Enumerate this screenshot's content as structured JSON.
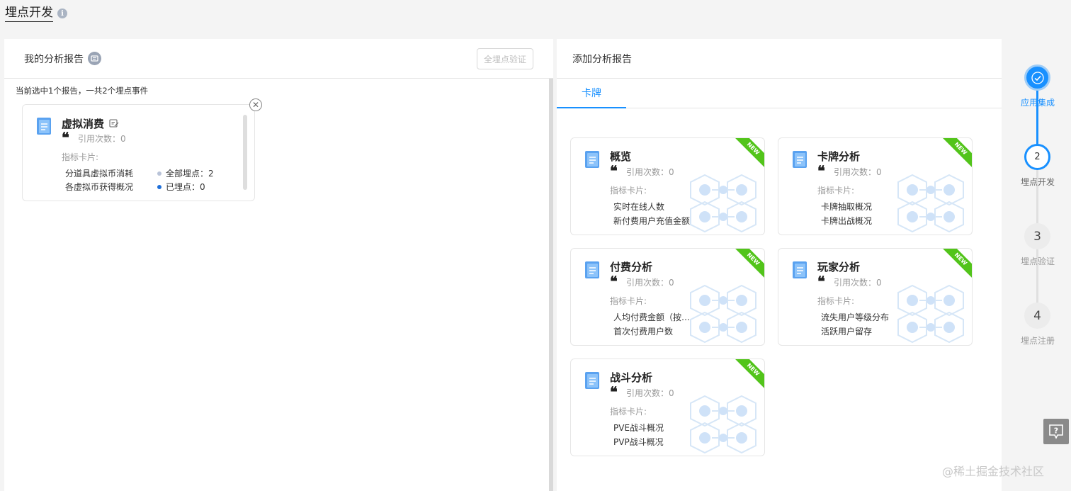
{
  "page": {
    "title": "埋点开发"
  },
  "left": {
    "title": "我的分析报告",
    "verify_button": "全埋点验证",
    "selected_info": "当前选中1个报告，一共2个埋点事件",
    "card": {
      "name": "虚拟消费",
      "ref_count": "引用次数：0",
      "metric_label": "指标卡片:",
      "metrics": [
        "分道具虚拟币消耗",
        "各虚拟币获得概况"
      ],
      "legend": [
        {
          "label": "全部埋点：2",
          "color": "#b9c3d8"
        },
        {
          "label": "已埋点：0",
          "color": "#1e6fd9"
        }
      ]
    }
  },
  "right": {
    "title": "添加分析报告",
    "tabs": [
      {
        "label": "卡牌"
      }
    ],
    "badge": "NEW",
    "cards": [
      {
        "name": "概览",
        "ref_count": "引用次数：0",
        "metric_label": "指标卡片:",
        "metrics": [
          "实时在线人数",
          "新付费用户充值金额"
        ]
      },
      {
        "name": "卡牌分析",
        "ref_count": "引用次数：0",
        "metric_label": "指标卡片:",
        "metrics": [
          "卡牌抽取概况",
          "卡牌出战概况"
        ]
      },
      {
        "name": "付费分析",
        "ref_count": "引用次数：0",
        "metric_label": "指标卡片:",
        "metrics": [
          "人均付费金额（按…",
          "首次付费用户数"
        ]
      },
      {
        "name": "玩家分析",
        "ref_count": "引用次数：0",
        "metric_label": "指标卡片:",
        "metrics": [
          "流失用户等级分布",
          "活跃用户留存"
        ]
      },
      {
        "name": "战斗分析",
        "ref_count": "引用次数：0",
        "metric_label": "指标卡片:",
        "metrics": [
          "PVE战斗概况",
          "PVP战斗概况"
        ]
      }
    ]
  },
  "steps": [
    {
      "number": "",
      "label": "应用集成"
    },
    {
      "number": "2",
      "label": "埋点开发"
    },
    {
      "number": "3",
      "label": "埋点验证"
    },
    {
      "number": "4",
      "label": "埋点注册"
    }
  ],
  "footer": {
    "watermark": "@稀土掘金技术社区"
  },
  "colors": {
    "accent": "#1890ff",
    "new_badge": "#52c41a"
  }
}
